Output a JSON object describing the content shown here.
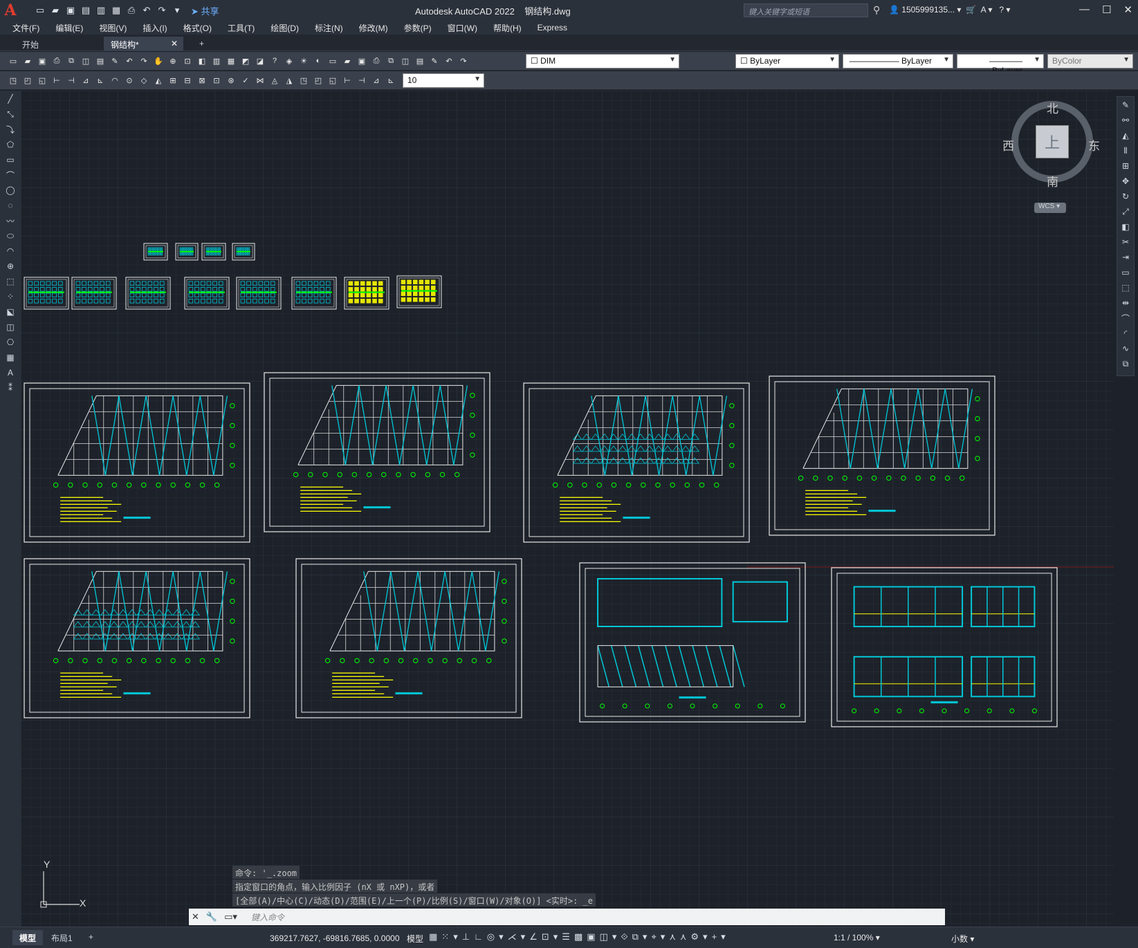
{
  "app": {
    "title": "Autodesk AutoCAD 2022",
    "filename": "钢结构.dwg",
    "share_label": "共享",
    "search_placeholder": "键入关键字或短语",
    "user": "1505999135...",
    "help": "?"
  },
  "menus": [
    "文件(F)",
    "编辑(E)",
    "视图(V)",
    "插入(I)",
    "格式(O)",
    "工具(T)",
    "绘图(D)",
    "标注(N)",
    "修改(M)",
    "参数(P)",
    "窗口(W)",
    "帮助(H)",
    "Express"
  ],
  "tabs": [
    {
      "label": "开始",
      "active": false
    },
    {
      "label": "钢结构*",
      "active": true
    }
  ],
  "toolbar": {
    "layer": "DIM",
    "color": "ByLayer",
    "linetype": "ByLayer",
    "lineweight": "ByLayer",
    "plotstyle": "ByColor",
    "text_height": "10"
  },
  "viewcube": {
    "north": "北",
    "south": "南",
    "east": "东",
    "west": "西",
    "top": "上",
    "wcs": "WCS"
  },
  "ucs": {
    "x": "X",
    "y": "Y"
  },
  "command": {
    "history": [
      "命令: '_.zoom",
      "指定窗口的角点，输入比例因子 (nX 或 nXP)，或者",
      "[全部(A)/中心(C)/动态(D)/范围(E)/上一个(P)/比例(S)/窗口(W)/对象(O)] <实时>: _e"
    ],
    "placeholder": "键入命令"
  },
  "status": {
    "model_tab": "模型",
    "layout_tab": "布局1",
    "coords": "369217.7627, -69816.7685, 0.0000",
    "mode": "模型",
    "scale": "1:1 / 100%",
    "units": "小数"
  },
  "colors": {
    "accent": "#00c8d8",
    "green": "#00ff00",
    "yellow": "#ffff00",
    "white": "#ffffff",
    "red": "#ff3030"
  }
}
